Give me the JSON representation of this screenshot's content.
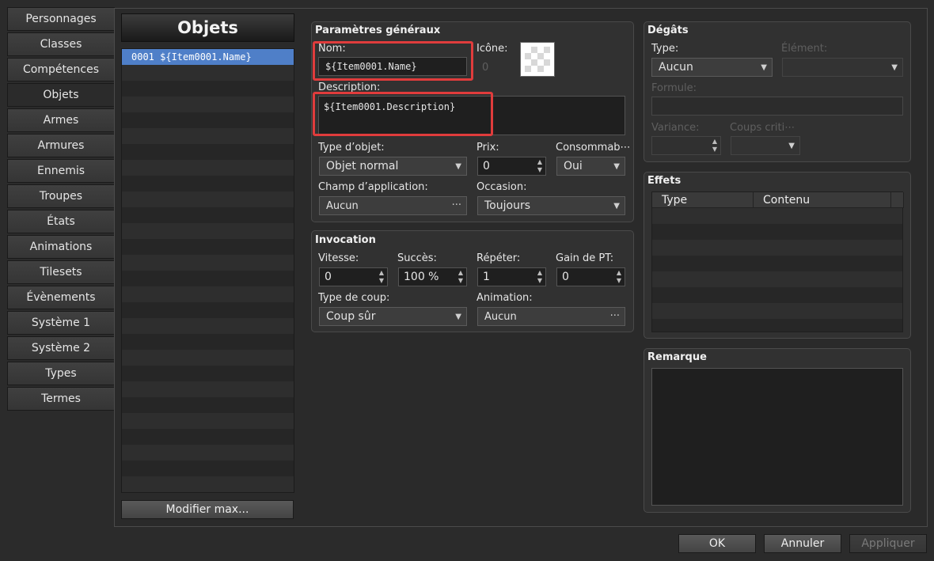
{
  "tabs": [
    {
      "label": "Personnages"
    },
    {
      "label": "Classes"
    },
    {
      "label": "Compétences"
    },
    {
      "label": "Objets",
      "active": true
    },
    {
      "label": "Armes"
    },
    {
      "label": "Armures"
    },
    {
      "label": "Ennemis"
    },
    {
      "label": "Troupes"
    },
    {
      "label": "États"
    },
    {
      "label": "Animations"
    },
    {
      "label": "Tilesets"
    },
    {
      "label": "Évènements"
    },
    {
      "label": "Système 1"
    },
    {
      "label": "Système 2"
    },
    {
      "label": "Types"
    },
    {
      "label": "Termes"
    }
  ],
  "list": {
    "title": "Objets",
    "items": [
      {
        "text": "0001  ${Item0001.Name}"
      }
    ],
    "modify_max_label": "Modifier max..."
  },
  "general": {
    "title": "Paramètres généraux",
    "name_label": "Nom:",
    "name_value": "${Item0001.Name}",
    "icon_label": "Icône:",
    "icon_index": "0",
    "description_label": "Description:",
    "description_value": "${Item0001.Description}",
    "item_type_label": "Type d’objet:",
    "item_type_value": "Objet normal",
    "price_label": "Prix:",
    "price_value": "0",
    "consumable_label": "Consommab⋯",
    "consumable_value": "Oui",
    "scope_label": "Champ d’application:",
    "scope_value": "Aucun",
    "occasion_label": "Occasion:",
    "occasion_value": "Toujours"
  },
  "invocation": {
    "title": "Invocation",
    "speed_label": "Vitesse:",
    "speed_value": "0",
    "success_label": "Succès:",
    "success_value": "100 %",
    "repeat_label": "Répéter:",
    "repeat_value": "1",
    "tp_gain_label": "Gain de PT:",
    "tp_gain_value": "0",
    "hit_type_label": "Type de coup:",
    "hit_type_value": "Coup sûr",
    "animation_label": "Animation:",
    "animation_value": "Aucun"
  },
  "damage": {
    "title": "Dégâts",
    "type_label": "Type:",
    "type_value": "Aucun",
    "element_label": "Élément:",
    "element_value": "",
    "formula_label": "Formule:",
    "formula_value": "",
    "variance_label": "Variance:",
    "variance_value": "",
    "critical_label": "Coups criti⋯",
    "critical_value": ""
  },
  "effects": {
    "title": "Effets",
    "columns": [
      "Type",
      "Contenu"
    ]
  },
  "note": {
    "title": "Remarque",
    "value": ""
  },
  "footer": {
    "ok_label": "OK",
    "cancel_label": "Annuler",
    "apply_label": "Appliquer"
  },
  "colors": {
    "highlight": "#e03c3c",
    "selection": "#4f7fc8"
  }
}
